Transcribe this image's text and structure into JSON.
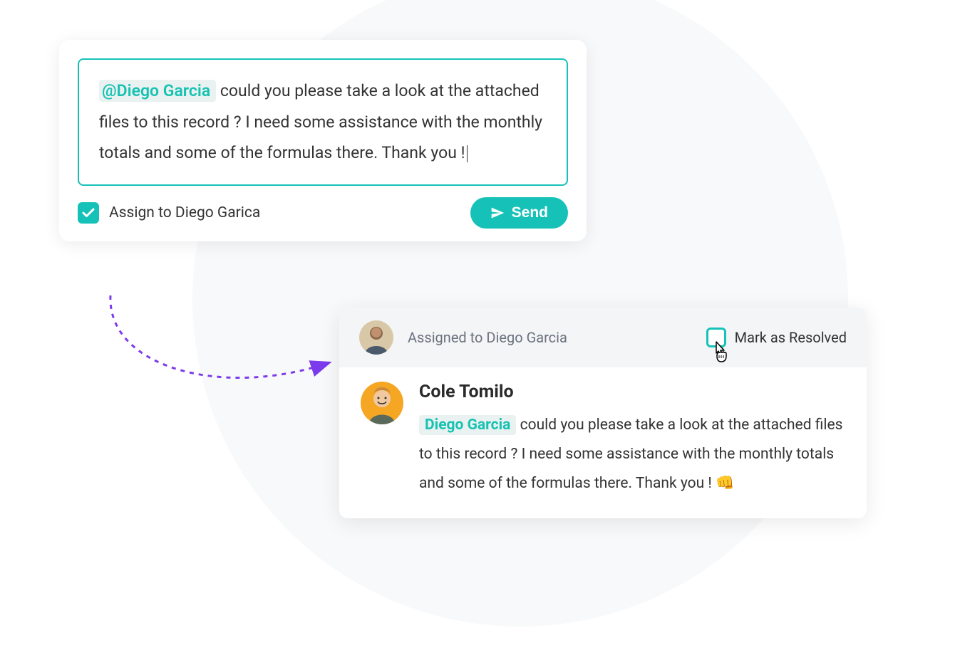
{
  "compose": {
    "mention": "@Diego Garcia",
    "text": " could you please take a look at the attached files to this record ? I need some assistance with the monthly totals and some of the formulas there. Thank you !",
    "assign_label": "Assign to Diego Garica",
    "assign_checked": true,
    "send_label": "Send"
  },
  "comment": {
    "assigned_label": "Assigned to Diego Garcia",
    "resolve_label": "Mark as Resolved",
    "resolve_checked": false,
    "author": "Cole Tomilo",
    "mention": "Diego Garcia",
    "text": " could you please take a look at the attached files to this record ? I need some assistance with the monthly totals and some of the formulas there. Thank you ! 👊"
  },
  "colors": {
    "accent": "#16c2b8",
    "arrow": "#7c3aed"
  }
}
